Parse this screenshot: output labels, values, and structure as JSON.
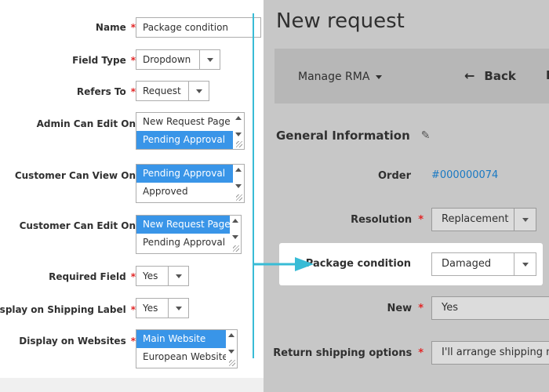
{
  "config_form": {
    "fields": [
      {
        "label": "Name",
        "required": true,
        "type": "text",
        "value": "Package condition"
      },
      {
        "label": "Field Type",
        "required": true,
        "type": "select",
        "value": "Dropdown"
      },
      {
        "label": "Refers To",
        "required": true,
        "type": "select",
        "value": "Request"
      },
      {
        "label": "Admin Can Edit On",
        "required": false,
        "type": "multiselect",
        "options": [
          "New Request Page",
          "Pending Approval"
        ],
        "selected": [
          1
        ]
      },
      {
        "label": "Customer Can View On",
        "required": false,
        "type": "multiselect",
        "options": [
          "Pending Approval",
          "Approved"
        ],
        "selected": [
          0
        ]
      },
      {
        "label": "Customer Can Edit On",
        "required": false,
        "type": "multiselect",
        "options": [
          "New Request Page",
          "Pending Approval"
        ],
        "selected": [
          0
        ]
      },
      {
        "label": "Required Field",
        "required": true,
        "type": "select",
        "value": "Yes"
      },
      {
        "label": "Display on Shipping Label",
        "required": true,
        "type": "select",
        "value": "Yes"
      },
      {
        "label": "Display on Websites",
        "required": true,
        "type": "multiselect",
        "options": [
          "Main Website",
          "European Website"
        ],
        "selected": [
          0
        ]
      }
    ]
  },
  "preview": {
    "page_title": "New request",
    "toolbar": {
      "menu_label": "Manage RMA",
      "back_label": "Back",
      "back_icon": "←",
      "more_label": "R"
    },
    "section": {
      "title": "General Information",
      "edit_icon": "✎"
    },
    "order": {
      "label": "Order",
      "value": "#000000074"
    },
    "resolution": {
      "label": "Resolution",
      "required": true,
      "value": "Replacement"
    },
    "package_condition": {
      "label": "Package condition",
      "value": "Damaged"
    },
    "new_field": {
      "label": "New",
      "required": true,
      "value": "Yes"
    },
    "return_shipping": {
      "label": "Return shipping options",
      "required": true,
      "value": "I'll arrange shipping my"
    }
  },
  "required_mark": "*",
  "colors": {
    "accent": "#38bcd6",
    "selection": "#3995e8",
    "required": "#e22626",
    "link": "#1979c3",
    "overlay": "#c7c7c7"
  }
}
